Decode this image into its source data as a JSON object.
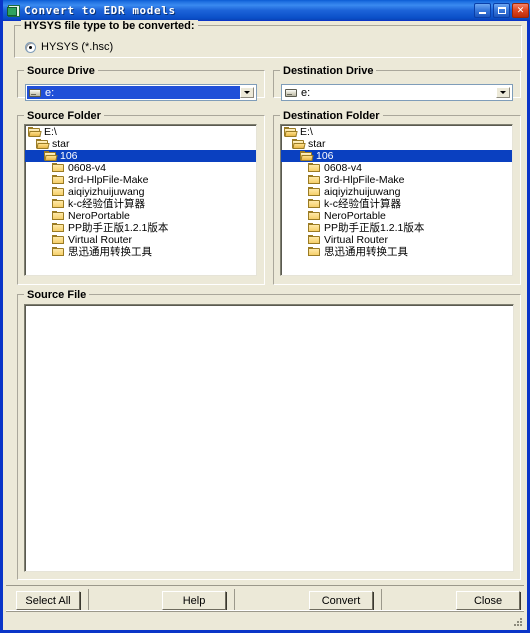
{
  "window": {
    "title": "Convert to EDR models",
    "icon": "document-convert-icon",
    "minimize_label": "Minimize",
    "maximize_label": "Maximize",
    "close_label": "Close",
    "accent_title_color": "#1E6FE0",
    "background_color": "#ECE9D8",
    "selection_color": "#0A40C0"
  },
  "file_type_group": {
    "label": "HYSYS file type to be converted:",
    "options": [
      {
        "label": "HYSYS  (*.hsc)",
        "selected": true
      }
    ]
  },
  "source": {
    "drive_group_label": "Source Drive",
    "drive_value": "e:",
    "drive_focused": true,
    "folder_group_label": "Source Folder",
    "file_group_label": "Source File",
    "folders": [
      {
        "label": "E:\\",
        "indent": 0,
        "open": true,
        "selected": false
      },
      {
        "label": "star",
        "indent": 1,
        "open": true,
        "selected": false
      },
      {
        "label": "106",
        "indent": 2,
        "open": true,
        "selected": true
      },
      {
        "label": "0608-v4",
        "indent": 3,
        "open": false,
        "selected": false
      },
      {
        "label": "3rd-HlpFile-Make",
        "indent": 3,
        "open": false,
        "selected": false
      },
      {
        "label": "aiqiyizhuijuwang",
        "indent": 3,
        "open": false,
        "selected": false
      },
      {
        "label": "k-c经验值计算器",
        "indent": 3,
        "open": false,
        "selected": false
      },
      {
        "label": "NeroPortable",
        "indent": 3,
        "open": false,
        "selected": false
      },
      {
        "label": "PP助手正版1.2.1版本",
        "indent": 3,
        "open": false,
        "selected": false
      },
      {
        "label": "Virtual Router",
        "indent": 3,
        "open": false,
        "selected": false
      },
      {
        "label": "思迅通用转换工具",
        "indent": 3,
        "open": false,
        "selected": false
      }
    ],
    "files": []
  },
  "destination": {
    "drive_group_label": "Destination Drive",
    "drive_value": "e:",
    "drive_focused": false,
    "folder_group_label": "Destination Folder",
    "folders": [
      {
        "label": "E:\\",
        "indent": 0,
        "open": true,
        "selected": false
      },
      {
        "label": "star",
        "indent": 1,
        "open": true,
        "selected": false
      },
      {
        "label": "106",
        "indent": 2,
        "open": true,
        "selected": true
      },
      {
        "label": "0608-v4",
        "indent": 3,
        "open": false,
        "selected": false
      },
      {
        "label": "3rd-HlpFile-Make",
        "indent": 3,
        "open": false,
        "selected": false
      },
      {
        "label": "aiqiyizhuijuwang",
        "indent": 3,
        "open": false,
        "selected": false
      },
      {
        "label": "k-c经验值计算器",
        "indent": 3,
        "open": false,
        "selected": false
      },
      {
        "label": "NeroPortable",
        "indent": 3,
        "open": false,
        "selected": false
      },
      {
        "label": "PP助手正版1.2.1版本",
        "indent": 3,
        "open": false,
        "selected": false
      },
      {
        "label": "Virtual Router",
        "indent": 3,
        "open": false,
        "selected": false
      },
      {
        "label": "思迅通用转换工具",
        "indent": 3,
        "open": false,
        "selected": false
      }
    ]
  },
  "buttons": {
    "select_all": "Select All",
    "help": "Help",
    "convert": "Convert",
    "close": "Close"
  }
}
